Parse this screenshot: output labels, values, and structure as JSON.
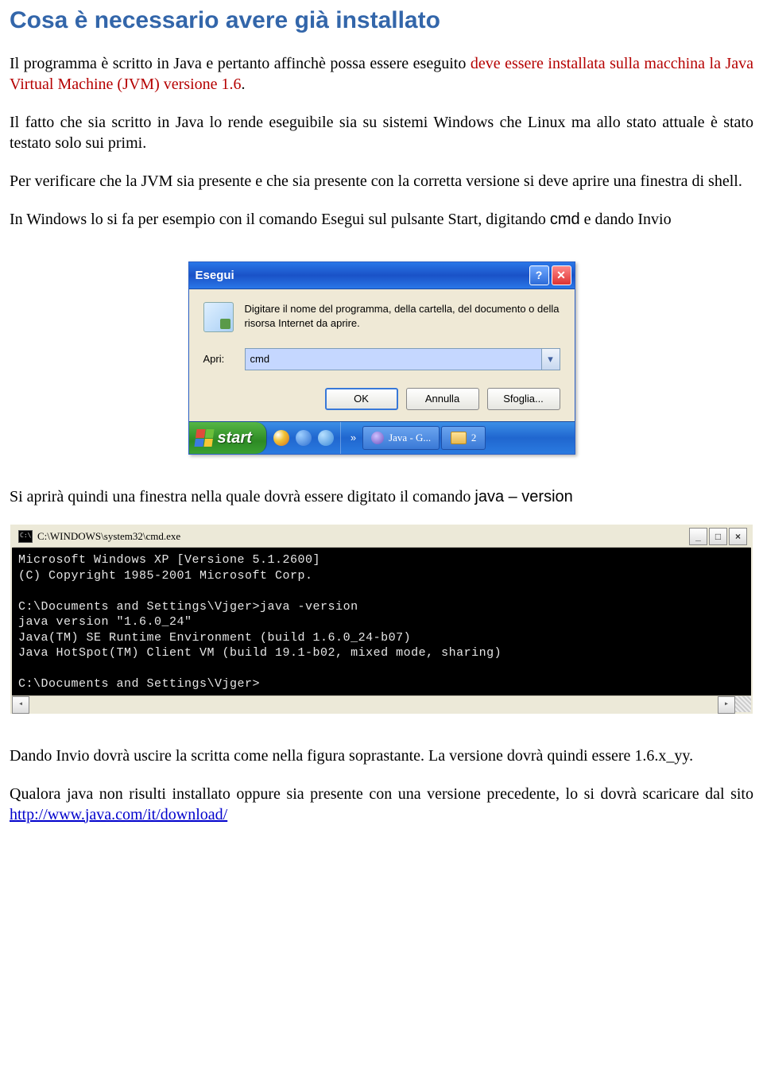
{
  "heading": "Cosa è necessario avere già installato",
  "para1": {
    "pre": "Il programma è scritto in Java e pertanto affinchè possa essere eseguito ",
    "red": "deve essere installata sulla macchina la Java Virtual Machine (JVM) versione 1.6",
    "post": "."
  },
  "para2": "Il fatto che sia scritto in Java lo rende eseguibile sia su sistemi Windows che Linux ma allo stato attuale è stato testato solo sui primi.",
  "para3": "Per verificare che la JVM sia presente e che sia presente con la corretta versione si deve aprire una finestra di shell.",
  "para4": {
    "pre": "In Windows lo si fa per esempio con il comando Esegui sul pulsante Start, digitando ",
    "code": "cmd",
    "post": " e dando Invio"
  },
  "run_dialog": {
    "title": "Esegui",
    "description": "Digitare il nome del programma, della cartella, del documento o della risorsa Internet da aprire.",
    "open_label": "Apri:",
    "value": "cmd",
    "ok": "OK",
    "cancel": "Annulla",
    "browse": "Sfoglia..."
  },
  "taskbar": {
    "start": "start",
    "task1": "Java - G...",
    "task2_prefix": "2"
  },
  "para5": {
    "pre": "Si aprirà quindi una finestra nella quale dovrà essere digitato il comando ",
    "code": "java – version"
  },
  "cmd": {
    "title": " C:\\WINDOWS\\system32\\cmd.exe",
    "lines": "Microsoft Windows XP [Versione 5.1.2600]\n(C) Copyright 1985-2001 Microsoft Corp.\n\nC:\\Documents and Settings\\Vjger>java -version\njava version \"1.6.0_24\"\nJava(TM) SE Runtime Environment (build 1.6.0_24-b07)\nJava HotSpot(TM) Client VM (build 19.1-b02, mixed mode, sharing)\n\nC:\\Documents and Settings\\Vjger>"
  },
  "para6": "Dando Invio dovrà uscire la scritta come nella figura soprastante. La versione dovrà quindi essere 1.6.x_yy.",
  "para7": {
    "pre": "Qualora java non risulti installato oppure sia presente con una versione precedente, lo si dovrà scaricare dal sito ",
    "link": "http://www.java.com/it/download/"
  }
}
